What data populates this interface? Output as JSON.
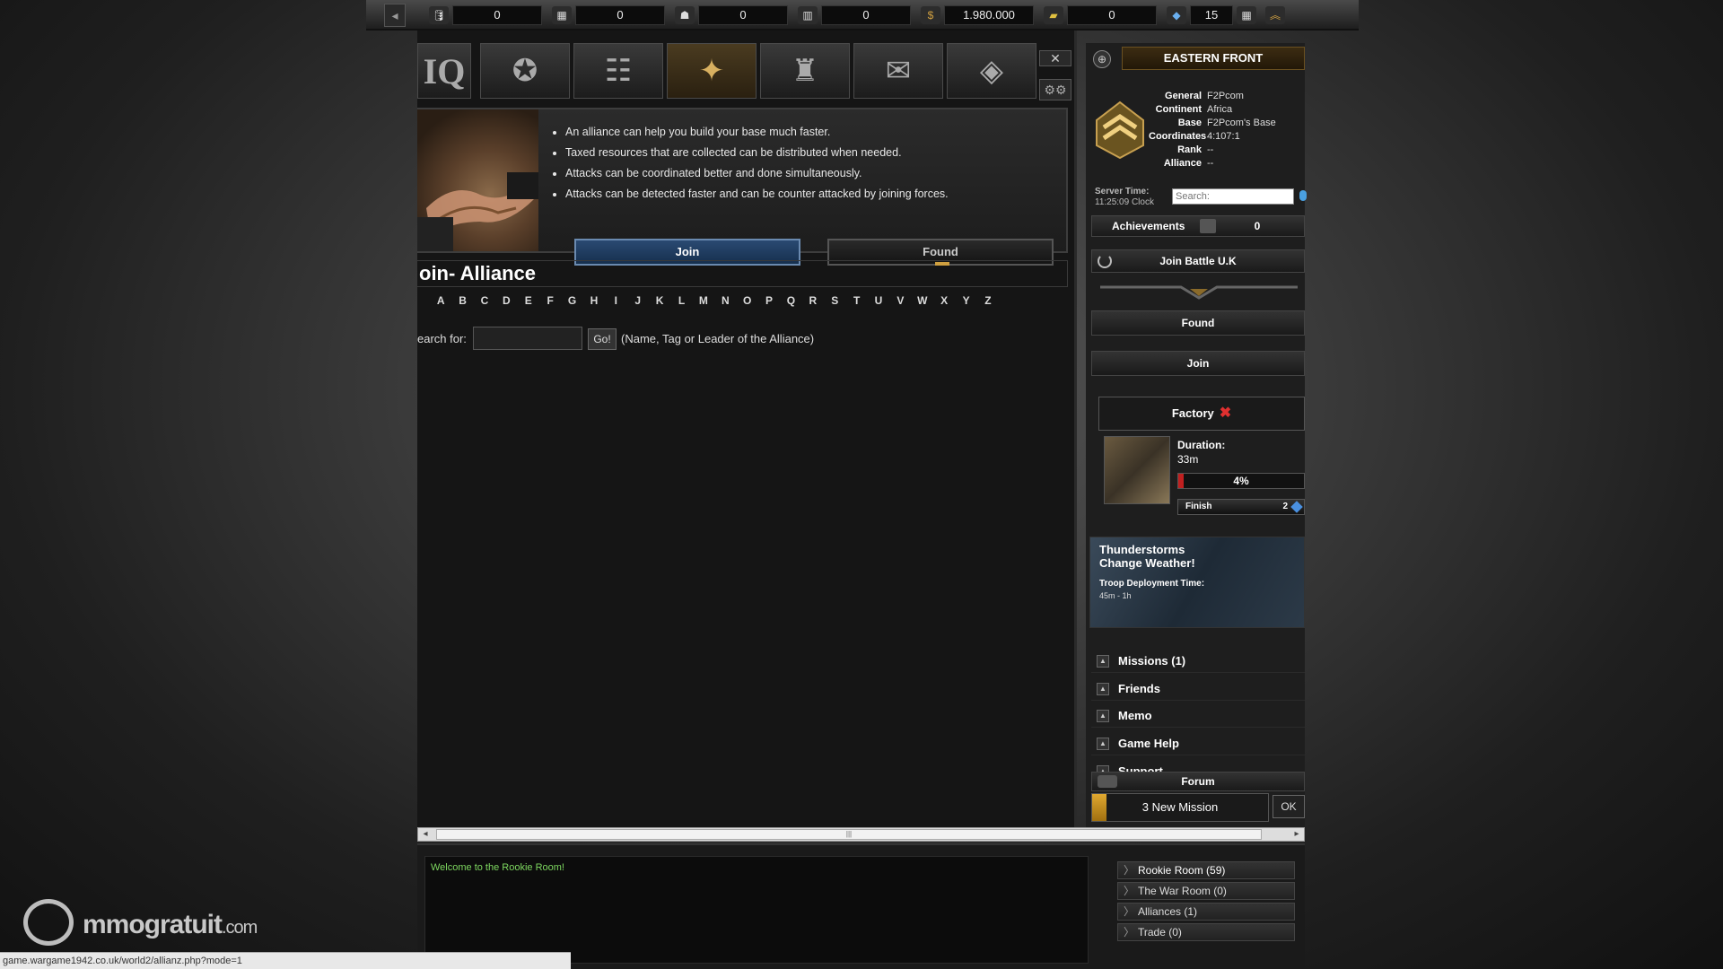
{
  "resources": [
    {
      "icon": "oil-icon",
      "value": "0"
    },
    {
      "icon": "steel-icon",
      "value": "0"
    },
    {
      "icon": "troops-icon",
      "value": "0"
    },
    {
      "icon": "ammo-icon",
      "value": "0"
    },
    {
      "icon": "money-icon",
      "value": "1.980.000"
    },
    {
      "icon": "gold-icon",
      "value": "0"
    },
    {
      "icon": "diamond-icon",
      "value": "15"
    }
  ],
  "nav": {
    "hq_label": "IQ"
  },
  "alliance": {
    "bullets": [
      "An alliance can help you build your base much faster.",
      "Taxed resources that are collected can be distributed when needed.",
      "Attacks can be coordinated better and done simultaneously.",
      "Attacks can be detected faster and can be counter attacked by joining forces."
    ],
    "join_label": "Join",
    "found_label": "Found",
    "section_title": "oin- Alliance",
    "letters": [
      "A",
      "B",
      "C",
      "D",
      "E",
      "F",
      "G",
      "H",
      "I",
      "J",
      "K",
      "L",
      "M",
      "N",
      "O",
      "P",
      "Q",
      "R",
      "S",
      "T",
      "U",
      "V",
      "W",
      "X",
      "Y",
      "Z"
    ],
    "search_label": "earch for:",
    "go_label": "Go!",
    "search_hint": "(Name, Tag or Leader of the Alliance)"
  },
  "sidebar": {
    "front_title": "EASTERN FRONT",
    "profile": [
      {
        "k": "General",
        "v": "F2Pcom"
      },
      {
        "k": "Continent",
        "v": "Africa"
      },
      {
        "k": "Base",
        "v": "F2Pcom's Base"
      },
      {
        "k": "Coordinates",
        "v": "4:107:1"
      },
      {
        "k": "Rank",
        "v": "--"
      },
      {
        "k": "Alliance",
        "v": "--"
      }
    ],
    "server_time_label": "Server Time:",
    "server_time_value": "11:25:09 Clock",
    "search_placeholder": "Search:",
    "achievements_label": "Achievements",
    "achievements_count": "0",
    "join_battle_label": "Join Battle U.K",
    "found_label": "Found",
    "join_label": "Join",
    "factory": {
      "label": "Factory",
      "duration_label": "Duration:",
      "duration_value": "33m",
      "progress_text": "4%",
      "progress": 0.04,
      "finish_label": "Finish",
      "finish_cost": "2"
    },
    "weather": {
      "title": "Thunderstorms Change Weather!",
      "deploy_label": "Troop Deployment Time:",
      "deploy_value": "45m - 1h"
    },
    "menu": [
      {
        "label": "Missions (1)"
      },
      {
        "label": "Friends"
      },
      {
        "label": "Memo"
      },
      {
        "label": "Game Help"
      },
      {
        "label": "Support"
      }
    ],
    "forum_label": "Forum",
    "new_mission_label": "3 New Mission",
    "ok_label": "OK"
  },
  "chat": {
    "welcome": "Welcome to the Rookie Room!",
    "rooms": [
      {
        "label": "Rookie Room (59)"
      },
      {
        "label": "The War Room (0)"
      },
      {
        "label": "Alliances (1)"
      },
      {
        "label": "Trade (0)"
      }
    ]
  },
  "statusbar": {
    "url": "game.wargame1942.co.uk/world2/allianz.php?mode=1"
  },
  "watermark": {
    "brand": "mmogratuit",
    "suffix": ".com"
  },
  "colors": {
    "accent_gold": "#d0a040",
    "join_blue": "#2a4a72",
    "chat_green": "#7ed860",
    "progress_red": "#c02020"
  }
}
